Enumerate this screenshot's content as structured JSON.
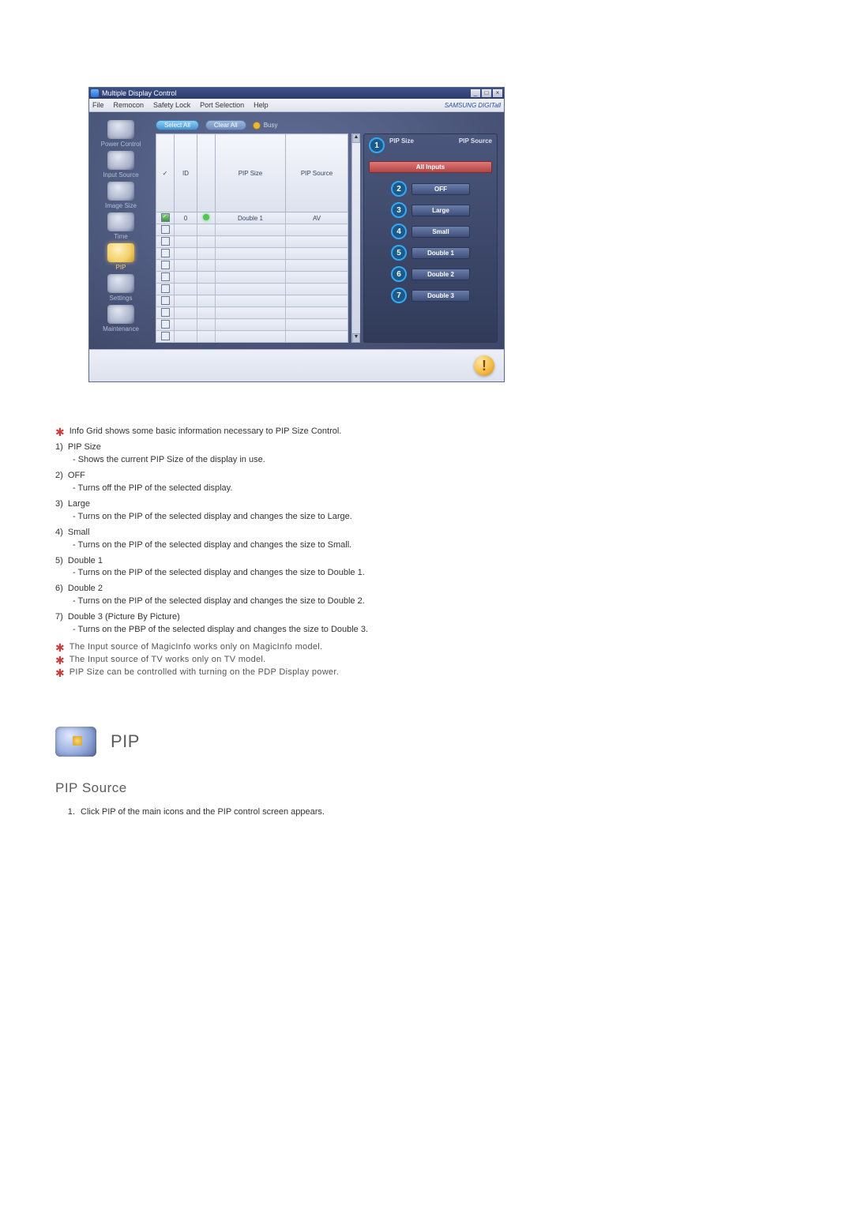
{
  "mdc": {
    "title": "Multiple Display Control",
    "window_buttons": {
      "min": "_",
      "max": "□",
      "close": "×"
    },
    "menu": {
      "file": "File",
      "remocon": "Remocon",
      "safety_lock": "Safety Lock",
      "port_selection": "Port Selection",
      "help": "Help"
    },
    "brand": "SAMSUNG DIGITall",
    "toolbar": {
      "select_all": "Select All",
      "clear_all": "Clear All",
      "busy": "Busy"
    },
    "sidebar": {
      "power": "Power Control",
      "input": "Input Source",
      "image": "Image Size",
      "time": "Time",
      "pip": "PIP",
      "settings": "Settings",
      "maintenance": "Maintenance"
    },
    "grid": {
      "cols": {
        "check": "✓",
        "id": "ID",
        "status": "",
        "pip_size": "PIP Size",
        "pip_source": "PIP Source"
      },
      "rows": [
        {
          "checked": true,
          "id": "0",
          "status": "green",
          "pip_size": "Double 1",
          "pip_source": "AV"
        },
        {
          "checked": false,
          "id": "",
          "status": "",
          "pip_size": "",
          "pip_source": ""
        },
        {
          "checked": false,
          "id": "",
          "status": "",
          "pip_size": "",
          "pip_source": ""
        },
        {
          "checked": false,
          "id": "",
          "status": "",
          "pip_size": "",
          "pip_source": ""
        },
        {
          "checked": false,
          "id": "",
          "status": "",
          "pip_size": "",
          "pip_source": ""
        },
        {
          "checked": false,
          "id": "",
          "status": "",
          "pip_size": "",
          "pip_source": ""
        },
        {
          "checked": false,
          "id": "",
          "status": "",
          "pip_size": "",
          "pip_source": ""
        },
        {
          "checked": false,
          "id": "",
          "status": "",
          "pip_size": "",
          "pip_source": ""
        },
        {
          "checked": false,
          "id": "",
          "status": "",
          "pip_size": "",
          "pip_source": ""
        },
        {
          "checked": false,
          "id": "",
          "status": "",
          "pip_size": "",
          "pip_source": ""
        },
        {
          "checked": false,
          "id": "",
          "status": "",
          "pip_size": "",
          "pip_source": ""
        }
      ]
    },
    "panel": {
      "size_label": "PIP Size",
      "source_label": "PIP Source",
      "all_inputs": "All Inputs",
      "options": [
        {
          "num": "2",
          "label": "OFF"
        },
        {
          "num": "3",
          "label": "Large"
        },
        {
          "num": "4",
          "label": "Small"
        },
        {
          "num": "5",
          "label": "Double 1"
        },
        {
          "num": "6",
          "label": "Double 2"
        },
        {
          "num": "7",
          "label": "Double 3"
        }
      ],
      "callout1": "1"
    }
  },
  "doc": {
    "intro_note": "Info Grid shows some basic information necessary to PIP Size Control.",
    "items": [
      {
        "n": "1)",
        "t": "PIP Size",
        "d": "- Shows the current PIP Size of the display in use."
      },
      {
        "n": "2)",
        "t": "OFF",
        "d": "- Turns off the PIP of the selected display."
      },
      {
        "n": "3)",
        "t": "Large",
        "d": "- Turns on the PIP of the selected display and changes the size to Large."
      },
      {
        "n": "4)",
        "t": "Small",
        "d": "- Turns on the PIP of the selected display and changes the size to Small."
      },
      {
        "n": "5)",
        "t": "Double 1",
        "d": "- Turns on the PIP of the selected display and changes the size to Double 1."
      },
      {
        "n": "6)",
        "t": "Double 2",
        "d": "- Turns on the PIP of the selected display and changes the size to Double 2."
      },
      {
        "n": "7)",
        "t": "Double 3 (Picture By Picture)",
        "d": "- Turns on the PBP of the selected display and changes the size to Double 3."
      }
    ],
    "footnotes": [
      "The Input source of MagicInfo works only on MagicInfo model.",
      "The Input source of TV works only on TV model.",
      "PIP Size can be controlled with turning on the PDP Display power."
    ],
    "section_label": "PIP",
    "subsection_label": "PIP Source",
    "step1": "Click PIP of the main icons and the PIP control screen appears."
  }
}
